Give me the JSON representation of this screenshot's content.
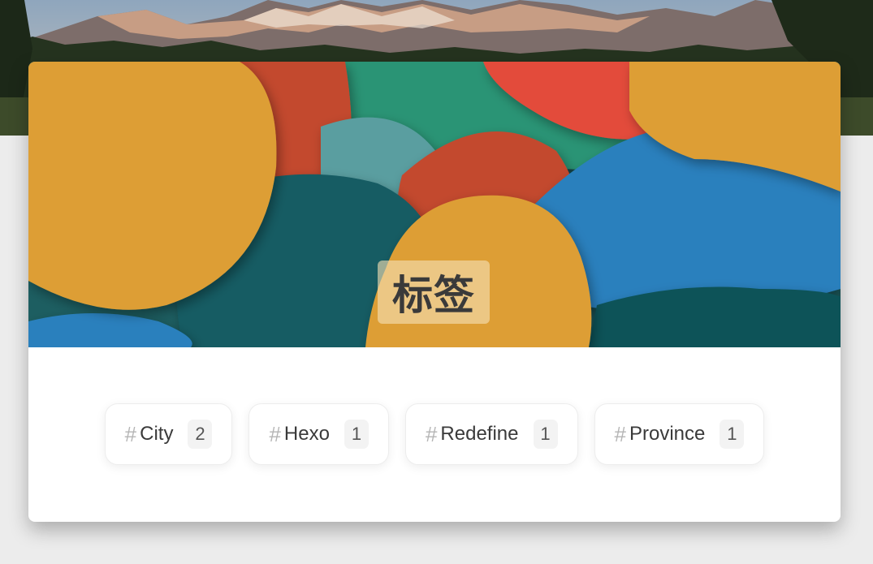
{
  "page": {
    "title": "标签"
  },
  "tags": [
    {
      "name": "City",
      "count": "2"
    },
    {
      "name": "Hexo",
      "count": "1"
    },
    {
      "name": "Redefine",
      "count": "1"
    },
    {
      "name": "Province",
      "count": "1"
    }
  ],
  "tag_prefix": "#",
  "colors": {
    "page_background": "#ececec",
    "card_background": "#ffffff",
    "blob_orange": "#dd9e35",
    "blob_red": "#c3482f",
    "blob_teal": "#135b63",
    "blob_blue": "#2a80bd",
    "blob_green": "#2a9474"
  }
}
